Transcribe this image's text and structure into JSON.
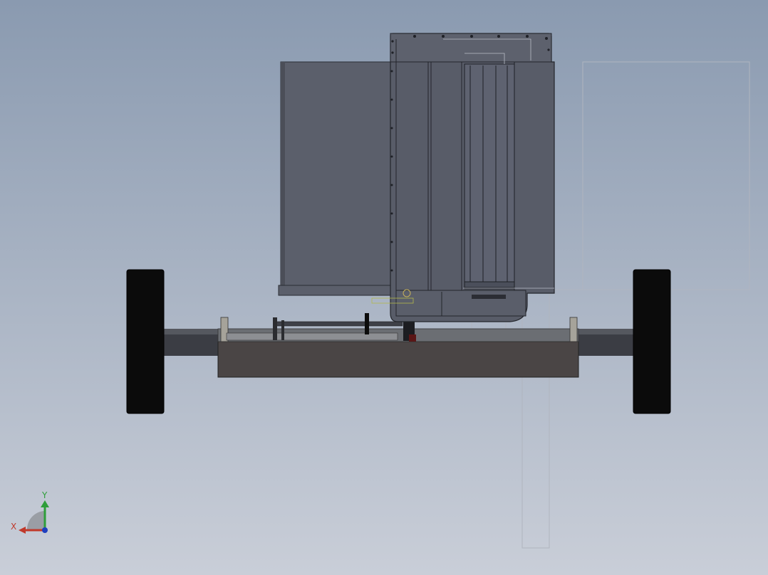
{
  "viewport": {
    "background_top": "#8a9ab0",
    "background_bottom": "#c9ced8"
  },
  "triad": {
    "x_label": "X",
    "y_label": "Y",
    "x_color": "#c0392b",
    "y_color": "#2e9e3a",
    "z_color": "#1f3fbf"
  },
  "model": {
    "colors": {
      "body": "#5b5f6b",
      "body_dark": "#4e525d",
      "edge": "#2a2c33",
      "base": "#4a4545",
      "axle": "#3a3c42",
      "wheel": "#0a0a0a",
      "sketch_lines": "#b8bcc4"
    }
  }
}
